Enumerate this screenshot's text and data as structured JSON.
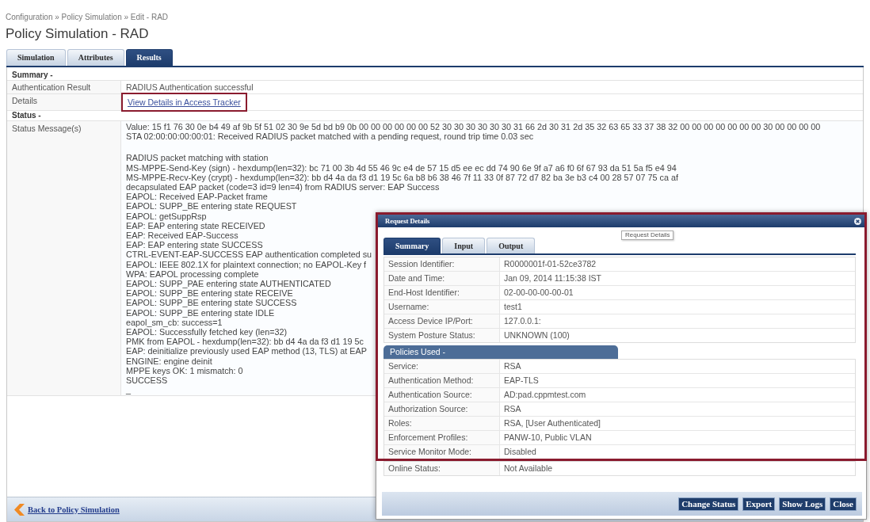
{
  "breadcrumb": "Configuration » Policy Simulation » Edit - RAD",
  "page_title": "Policy Simulation - RAD",
  "tabs": [
    {
      "label": "Simulation",
      "selected": false
    },
    {
      "label": "Attributes",
      "selected": false
    },
    {
      "label": "Results",
      "selected": true
    }
  ],
  "sections": [
    {
      "title": "Summary -",
      "rows": [
        {
          "kind": "text",
          "label": "Authentication Result",
          "value": "RADIUS Authentication successful"
        },
        {
          "kind": "link",
          "label": "Details",
          "value": "View Details in Access Tracker",
          "highlighted": true
        }
      ]
    },
    {
      "title": "Status -",
      "rows": [
        {
          "kind": "log",
          "label": "Status Message(s)",
          "paragraphs": [
            [
              "Value: 15 f1 76 30 0e b4 49 af 9b 5f 51 02 30 9e 5d bd b9 0b 00 00 00 00 00 00 52 30 30 30 30 30 30 31 66 2d 30 31 2d 35 32 63 65 33 37 38 32 00 00 00 00 00 00 00 30 00 00 00 00",
              "STA 02:00:00:00:00:01: Received RADIUS packet matched with a pending request, round trip time 0.03 sec"
            ],
            [
              "RADIUS packet matching with station",
              "MS-MPPE-Send-Key (sign) - hexdump(len=32): bc 71 00 3b 4d 55 46 9c e4 de 57 15 d5 ee ec dd 74 90 6e 9f a7 a6 f0 6f 67 93 da 51 5a f5 e4 94",
              "MS-MPPE-Recv-Key (crypt) - hexdump(len=32): bb d4 4a da f3 d1 19 5c 6a b8 b6 38 46 7f 11 33 0f 87 72 d7 82 ba 3e b3 c4 00 28 57 07 75 ca af",
              "decapsulated EAP packet (code=3 id=9 len=4) from RADIUS server: EAP Success",
              "EAPOL: Received EAP-Packet frame",
              "EAPOL: SUPP_BE entering state REQUEST",
              "EAPOL: getSuppRsp",
              "EAP: EAP entering state RECEIVED",
              "EAP: Received EAP-Success",
              "EAP: EAP entering state SUCCESS",
              "CTRL-EVENT-EAP-SUCCESS EAP authentication completed su",
              "EAPOL: IEEE 802.1X for plaintext connection; no EAPOL-Key f",
              "WPA: EAPOL processing complete",
              "EAPOL: SUPP_PAE entering state AUTHENTICATED",
              "EAPOL: SUPP_BE entering state RECEIVE",
              "EAPOL: SUPP_BE entering state SUCCESS",
              "EAPOL: SUPP_BE entering state IDLE",
              "eapol_sm_cb: success=1",
              "EAPOL: Successfully fetched key (len=32)",
              "PMK from EAPOL - hexdump(len=32): bb d4 4a da f3 d1 19 5c",
              "EAP: deinitialize previously used EAP method (13, TLS) at EAP",
              "ENGINE: engine deinit",
              "MPPE keys OK: 1 mismatch: 0",
              "SUCCESS",
              "_"
            ]
          ]
        }
      ]
    }
  ],
  "back_link": "Back to Policy Simulation",
  "dialog": {
    "title": "Request Details",
    "highlighted": true,
    "tooltip": "Request Details",
    "tabs": [
      {
        "label": "Summary",
        "selected": true
      },
      {
        "label": "Input",
        "selected": false
      },
      {
        "label": "Output",
        "selected": false
      }
    ],
    "summary_rows": [
      {
        "label": "Session Identifier:",
        "value": "R0000001f-01-52ce3782"
      },
      {
        "label": "Date and Time:",
        "value": "Jan 09, 2014 11:15:38 IST"
      },
      {
        "label": "End-Host Identifier:",
        "value": "02-00-00-00-00-01"
      },
      {
        "label": "Username:",
        "value": "test1"
      },
      {
        "label": "Access Device IP/Port:",
        "value": "127.0.0.1:"
      },
      {
        "label": "System Posture Status:",
        "value": "UNKNOWN (100)"
      }
    ],
    "policies_title": "Policies Used -",
    "policy_rows": [
      {
        "label": "Service:",
        "value": "RSA"
      },
      {
        "label": "Authentication Method:",
        "value": "EAP-TLS"
      },
      {
        "label": "Authentication Source:",
        "value": "AD:pad.cppmtest.com"
      },
      {
        "label": "Authorization Source:",
        "value": "RSA"
      },
      {
        "label": "Roles:",
        "value": "RSA, [User Authenticated]"
      },
      {
        "label": "Enforcement Profiles:",
        "value": "PANW-10, Public VLAN"
      },
      {
        "label": "Service Monitor Mode:",
        "value": "Disabled"
      }
    ],
    "rows_below": [
      {
        "label": "Online Status:",
        "value": "Not Available"
      }
    ],
    "buttons": [
      "Change Status",
      "Export",
      "Show Logs",
      "Close"
    ]
  }
}
